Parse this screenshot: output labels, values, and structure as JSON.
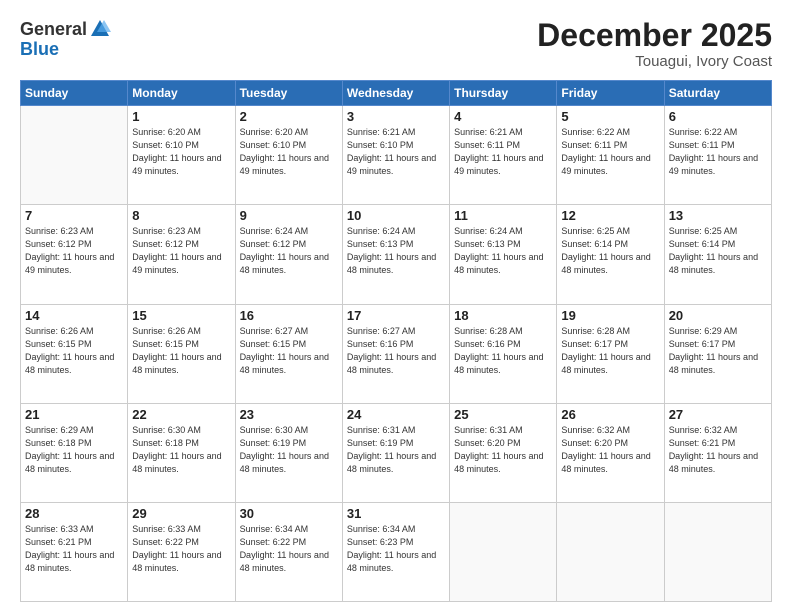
{
  "header": {
    "logo_general": "General",
    "logo_blue": "Blue",
    "month": "December 2025",
    "location": "Touagui, Ivory Coast"
  },
  "weekdays": [
    "Sunday",
    "Monday",
    "Tuesday",
    "Wednesday",
    "Thursday",
    "Friday",
    "Saturday"
  ],
  "weeks": [
    [
      {
        "day": "",
        "sunrise": "",
        "sunset": "",
        "daylight": ""
      },
      {
        "day": "1",
        "sunrise": "Sunrise: 6:20 AM",
        "sunset": "Sunset: 6:10 PM",
        "daylight": "Daylight: 11 hours and 49 minutes."
      },
      {
        "day": "2",
        "sunrise": "Sunrise: 6:20 AM",
        "sunset": "Sunset: 6:10 PM",
        "daylight": "Daylight: 11 hours and 49 minutes."
      },
      {
        "day": "3",
        "sunrise": "Sunrise: 6:21 AM",
        "sunset": "Sunset: 6:10 PM",
        "daylight": "Daylight: 11 hours and 49 minutes."
      },
      {
        "day": "4",
        "sunrise": "Sunrise: 6:21 AM",
        "sunset": "Sunset: 6:11 PM",
        "daylight": "Daylight: 11 hours and 49 minutes."
      },
      {
        "day": "5",
        "sunrise": "Sunrise: 6:22 AM",
        "sunset": "Sunset: 6:11 PM",
        "daylight": "Daylight: 11 hours and 49 minutes."
      },
      {
        "day": "6",
        "sunrise": "Sunrise: 6:22 AM",
        "sunset": "Sunset: 6:11 PM",
        "daylight": "Daylight: 11 hours and 49 minutes."
      }
    ],
    [
      {
        "day": "7",
        "sunrise": "Sunrise: 6:23 AM",
        "sunset": "Sunset: 6:12 PM",
        "daylight": "Daylight: 11 hours and 49 minutes."
      },
      {
        "day": "8",
        "sunrise": "Sunrise: 6:23 AM",
        "sunset": "Sunset: 6:12 PM",
        "daylight": "Daylight: 11 hours and 49 minutes."
      },
      {
        "day": "9",
        "sunrise": "Sunrise: 6:24 AM",
        "sunset": "Sunset: 6:12 PM",
        "daylight": "Daylight: 11 hours and 48 minutes."
      },
      {
        "day": "10",
        "sunrise": "Sunrise: 6:24 AM",
        "sunset": "Sunset: 6:13 PM",
        "daylight": "Daylight: 11 hours and 48 minutes."
      },
      {
        "day": "11",
        "sunrise": "Sunrise: 6:24 AM",
        "sunset": "Sunset: 6:13 PM",
        "daylight": "Daylight: 11 hours and 48 minutes."
      },
      {
        "day": "12",
        "sunrise": "Sunrise: 6:25 AM",
        "sunset": "Sunset: 6:14 PM",
        "daylight": "Daylight: 11 hours and 48 minutes."
      },
      {
        "day": "13",
        "sunrise": "Sunrise: 6:25 AM",
        "sunset": "Sunset: 6:14 PM",
        "daylight": "Daylight: 11 hours and 48 minutes."
      }
    ],
    [
      {
        "day": "14",
        "sunrise": "Sunrise: 6:26 AM",
        "sunset": "Sunset: 6:15 PM",
        "daylight": "Daylight: 11 hours and 48 minutes."
      },
      {
        "day": "15",
        "sunrise": "Sunrise: 6:26 AM",
        "sunset": "Sunset: 6:15 PM",
        "daylight": "Daylight: 11 hours and 48 minutes."
      },
      {
        "day": "16",
        "sunrise": "Sunrise: 6:27 AM",
        "sunset": "Sunset: 6:15 PM",
        "daylight": "Daylight: 11 hours and 48 minutes."
      },
      {
        "day": "17",
        "sunrise": "Sunrise: 6:27 AM",
        "sunset": "Sunset: 6:16 PM",
        "daylight": "Daylight: 11 hours and 48 minutes."
      },
      {
        "day": "18",
        "sunrise": "Sunrise: 6:28 AM",
        "sunset": "Sunset: 6:16 PM",
        "daylight": "Daylight: 11 hours and 48 minutes."
      },
      {
        "day": "19",
        "sunrise": "Sunrise: 6:28 AM",
        "sunset": "Sunset: 6:17 PM",
        "daylight": "Daylight: 11 hours and 48 minutes."
      },
      {
        "day": "20",
        "sunrise": "Sunrise: 6:29 AM",
        "sunset": "Sunset: 6:17 PM",
        "daylight": "Daylight: 11 hours and 48 minutes."
      }
    ],
    [
      {
        "day": "21",
        "sunrise": "Sunrise: 6:29 AM",
        "sunset": "Sunset: 6:18 PM",
        "daylight": "Daylight: 11 hours and 48 minutes."
      },
      {
        "day": "22",
        "sunrise": "Sunrise: 6:30 AM",
        "sunset": "Sunset: 6:18 PM",
        "daylight": "Daylight: 11 hours and 48 minutes."
      },
      {
        "day": "23",
        "sunrise": "Sunrise: 6:30 AM",
        "sunset": "Sunset: 6:19 PM",
        "daylight": "Daylight: 11 hours and 48 minutes."
      },
      {
        "day": "24",
        "sunrise": "Sunrise: 6:31 AM",
        "sunset": "Sunset: 6:19 PM",
        "daylight": "Daylight: 11 hours and 48 minutes."
      },
      {
        "day": "25",
        "sunrise": "Sunrise: 6:31 AM",
        "sunset": "Sunset: 6:20 PM",
        "daylight": "Daylight: 11 hours and 48 minutes."
      },
      {
        "day": "26",
        "sunrise": "Sunrise: 6:32 AM",
        "sunset": "Sunset: 6:20 PM",
        "daylight": "Daylight: 11 hours and 48 minutes."
      },
      {
        "day": "27",
        "sunrise": "Sunrise: 6:32 AM",
        "sunset": "Sunset: 6:21 PM",
        "daylight": "Daylight: 11 hours and 48 minutes."
      }
    ],
    [
      {
        "day": "28",
        "sunrise": "Sunrise: 6:33 AM",
        "sunset": "Sunset: 6:21 PM",
        "daylight": "Daylight: 11 hours and 48 minutes."
      },
      {
        "day": "29",
        "sunrise": "Sunrise: 6:33 AM",
        "sunset": "Sunset: 6:22 PM",
        "daylight": "Daylight: 11 hours and 48 minutes."
      },
      {
        "day": "30",
        "sunrise": "Sunrise: 6:34 AM",
        "sunset": "Sunset: 6:22 PM",
        "daylight": "Daylight: 11 hours and 48 minutes."
      },
      {
        "day": "31",
        "sunrise": "Sunrise: 6:34 AM",
        "sunset": "Sunset: 6:23 PM",
        "daylight": "Daylight: 11 hours and 48 minutes."
      },
      {
        "day": "",
        "sunrise": "",
        "sunset": "",
        "daylight": ""
      },
      {
        "day": "",
        "sunrise": "",
        "sunset": "",
        "daylight": ""
      },
      {
        "day": "",
        "sunrise": "",
        "sunset": "",
        "daylight": ""
      }
    ]
  ]
}
